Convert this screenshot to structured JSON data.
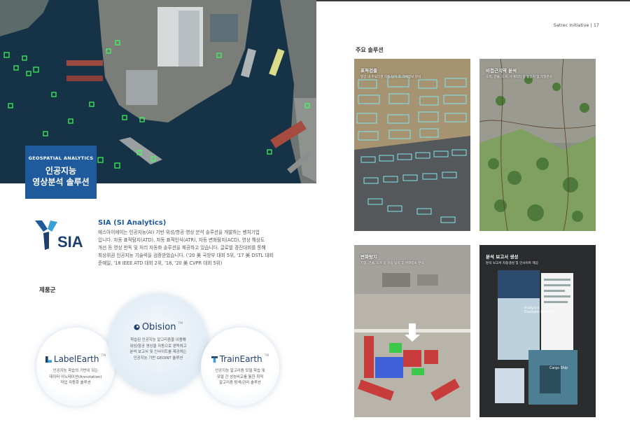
{
  "left_page": {
    "hero": {
      "badge_kicker": "GEOSPATIAL ANALYTICS",
      "badge_title_line1": "인공지능",
      "badge_title_line2": "영상분석 솔루션"
    },
    "company": {
      "logo_text": "SIA",
      "name": "SIA (SI Analytics)",
      "description": [
        "에스아이에이는 인공지능(AI) 기반 위성/항공 영상 분석 솔루션을 개발하는 벤처기업",
        "입니다. 자동 표적탐지(ATD), 자동 표적인식(ATR), 자동 변화탐지(ACD), 영상 해상도",
        "개선 등 영상 판독 및 처리 자동화 솔루션을 제공하고 있습니다. 글로벌 경진대회를 통해",
        "최상위권 인공지능 기술력을 검증받았습니다. ('20 美 국방부 대회 5위, '17 美 DSTL 대회",
        "준예일, '18 IEEE ATD 대회 2위, '18, '20 美 CVPR 대회 5위)"
      ]
    },
    "products_heading": "제품군",
    "products": [
      {
        "name": "LabelEarth",
        "tm": "TM",
        "desc": [
          "인공지능 학습의 기반이 되는",
          "데이터 어노테이션(Annotation)",
          "작업 자동화 솔루션"
        ]
      },
      {
        "name": "Obision",
        "tm": "TM",
        "desc": [
          "학습된 인공지능 알고리즘을 이용해",
          "위성/항공 영상을 자동으로 판독하고",
          "분석 보고서 및 인사이트를 제공하는",
          "인공지능 기반 GEOINT 솔루션"
        ]
      },
      {
        "name": "TrainEarth",
        "tm": "TM",
        "desc": [
          "인공지능 알고리즘 모델 학습 및",
          "모델 간 성능비교를 통한 최적",
          "알고리즘 탐색/관리 솔루션"
        ]
      }
    ]
  },
  "right_page": {
    "running_head": "Satrec Initiative  |  17",
    "section_title": "주요 솔루션",
    "tiles": [
      {
        "title": "표적검출",
        "subtitle": "영상 내 주요타겟 자동 탐지 후 객체정보 분석"
      },
      {
        "title": "비접근지역 분석",
        "subtitle": "초목, 건물, 도로, 수계지역 등 활용지 및 지형분석"
      },
      {
        "title": "변화탐지",
        "subtitle": "지형, 건물, 도로 등 자동 탐지 후 변화정보 분석"
      },
      {
        "title": "분석 보고서 생성",
        "subtitle": "분석 보고서 자동생성 및 인사이트 제공"
      }
    ],
    "report_card": {
      "title_line1": "Analytics",
      "title_line2": "Custom Report",
      "cargo_label": "Cargo Ship"
    }
  },
  "colors": {
    "brand_blue": "#1e5a9c",
    "dark_navy": "#1d3f6e",
    "detection_green": "#3cff5a",
    "detection_cyan": "#7fe6f0"
  }
}
